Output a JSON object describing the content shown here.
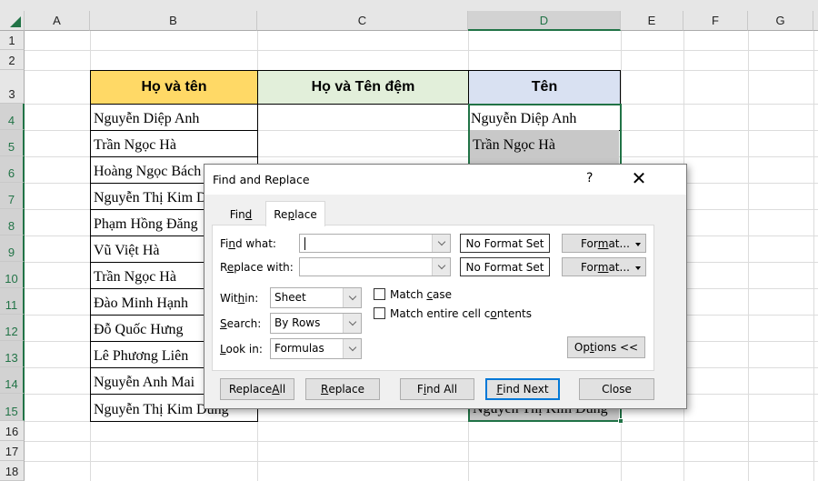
{
  "spreadsheet": {
    "columns": [
      "A",
      "B",
      "C",
      "D",
      "E",
      "F",
      "G"
    ],
    "rows": [
      "1",
      "2",
      "3",
      "4",
      "5",
      "6",
      "7",
      "8",
      "9",
      "10",
      "11",
      "12",
      "13",
      "14",
      "15",
      "16",
      "17",
      "18"
    ],
    "selected_column": "D",
    "headers": {
      "b": "Họ và tên",
      "c": "Họ và Tên đệm",
      "d": "Tên"
    },
    "header_colors": {
      "b": "#ffd966",
      "c": "#e2efda",
      "d": "#d9e1f2"
    },
    "column_b": [
      "Nguyễn Diệp Anh",
      "Trần Ngọc Hà",
      "Hoàng Ngọc Bách",
      "Nguyễn Thị Kim Dung",
      "Phạm Hồng Đăng",
      "Vũ Việt Hà",
      "Trần Ngọc Hà",
      "Đào Minh Hạnh",
      "Đỗ Quốc Hưng",
      "Lê Phương Liên",
      "Nguyễn Anh Mai",
      "Nguyễn Thị Kim Dung"
    ],
    "column_d_visible": {
      "row4": "Nguyễn Diệp Anh",
      "row5": "Trần Ngọc Hà",
      "row15": "Nguyễn Thị Kim Dung"
    },
    "accent_color": "#217346"
  },
  "dialog": {
    "title": "Find and Replace",
    "help_label": "?",
    "close_label": "✕",
    "tabs": [
      {
        "label_pre": "Fin",
        "label_ul": "d",
        "label_post": "",
        "active": false
      },
      {
        "label_pre": "Re",
        "label_ul": "p",
        "label_post": "lace",
        "active": true
      }
    ],
    "find_what": {
      "label_pre": "Fi",
      "label_ul": "n",
      "label_post": "d what:",
      "value": ""
    },
    "replace_with": {
      "label_pre": "R",
      "label_ul": "e",
      "label_post": "place with:",
      "value": ""
    },
    "no_format_label": "No Format Set",
    "format_button": {
      "pre": "For",
      "ul": "m",
      "post": "at..."
    },
    "within": {
      "label_pre": "Wit",
      "label_ul": "h",
      "label_post": "in:",
      "value": "Sheet"
    },
    "search": {
      "label_pre": "",
      "label_ul": "S",
      "label_post": "earch:",
      "value": "By Rows"
    },
    "look_in": {
      "label_pre": "",
      "label_ul": "L",
      "label_post": "ook in:",
      "value": "Formulas"
    },
    "match_case": {
      "pre": "Match ",
      "ul": "c",
      "post": "ase",
      "checked": false
    },
    "match_entire": {
      "pre": "Match entire cell c",
      "ul": "o",
      "post": "ntents",
      "checked": false
    },
    "options_button": {
      "pre": "Op",
      "ul": "t",
      "post": "ions <<"
    },
    "buttons": {
      "replace_all": {
        "pre": "Replace ",
        "ul": "A",
        "post": "ll"
      },
      "replace": {
        "pre": "",
        "ul": "R",
        "post": "eplace"
      },
      "find_all": {
        "pre": "F",
        "ul": "i",
        "post": "nd All"
      },
      "find_next": {
        "pre": "",
        "ul": "F",
        "post": "ind Next"
      },
      "close": {
        "pre": "Close",
        "ul": "",
        "post": ""
      }
    }
  }
}
